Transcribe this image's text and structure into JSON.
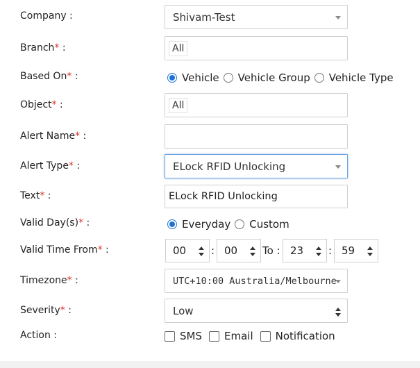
{
  "form": {
    "company": {
      "label": "Company :",
      "value": "Shivam-Test"
    },
    "branch": {
      "label": "Branch",
      "suffix": " :",
      "required_mark": "*",
      "chip": "All"
    },
    "based_on": {
      "label": "Based On",
      "suffix": " :",
      "required_mark": "*",
      "options": [
        "Vehicle",
        "Vehicle Group",
        "Vehicle Type"
      ],
      "selected": "Vehicle"
    },
    "object": {
      "label": "Object",
      "suffix": " :",
      "required_mark": "*",
      "chip": "All"
    },
    "alert_name": {
      "label": "Alert Name",
      "suffix": " :",
      "required_mark": "*",
      "value": ""
    },
    "alert_type": {
      "label": "Alert Type",
      "suffix": " :",
      "required_mark": "*",
      "value": "ELock RFID Unlocking"
    },
    "text": {
      "label": "Text",
      "suffix": " :",
      "required_mark": "*",
      "value": "ELock RFID Unlocking"
    },
    "valid_days": {
      "label": "Valid Day(s)",
      "suffix": " :",
      "required_mark": "*",
      "options": [
        "Everyday",
        "Custom"
      ],
      "selected": "Everyday"
    },
    "valid_time": {
      "label": "Valid Time From",
      "suffix": " :",
      "required_mark": "*",
      "from_hour": "00",
      "from_minute": "00",
      "to_label": "To :",
      "to_hour": "23",
      "to_minute": "59",
      "colon": ":"
    },
    "timezone": {
      "label": "Timezone",
      "suffix": " :",
      "required_mark": "*",
      "value": "UTC+10:00 Australia/Melbourne"
    },
    "severity": {
      "label": "Severity",
      "suffix": " :",
      "required_mark": "*",
      "value": "Low"
    },
    "action": {
      "label": "Action :",
      "options": [
        "SMS",
        "Email",
        "Notification"
      ]
    }
  },
  "colors": {
    "required": "#d9332b",
    "radio_selected": "#1e73d8",
    "focus_border": "#6aa0dd"
  }
}
